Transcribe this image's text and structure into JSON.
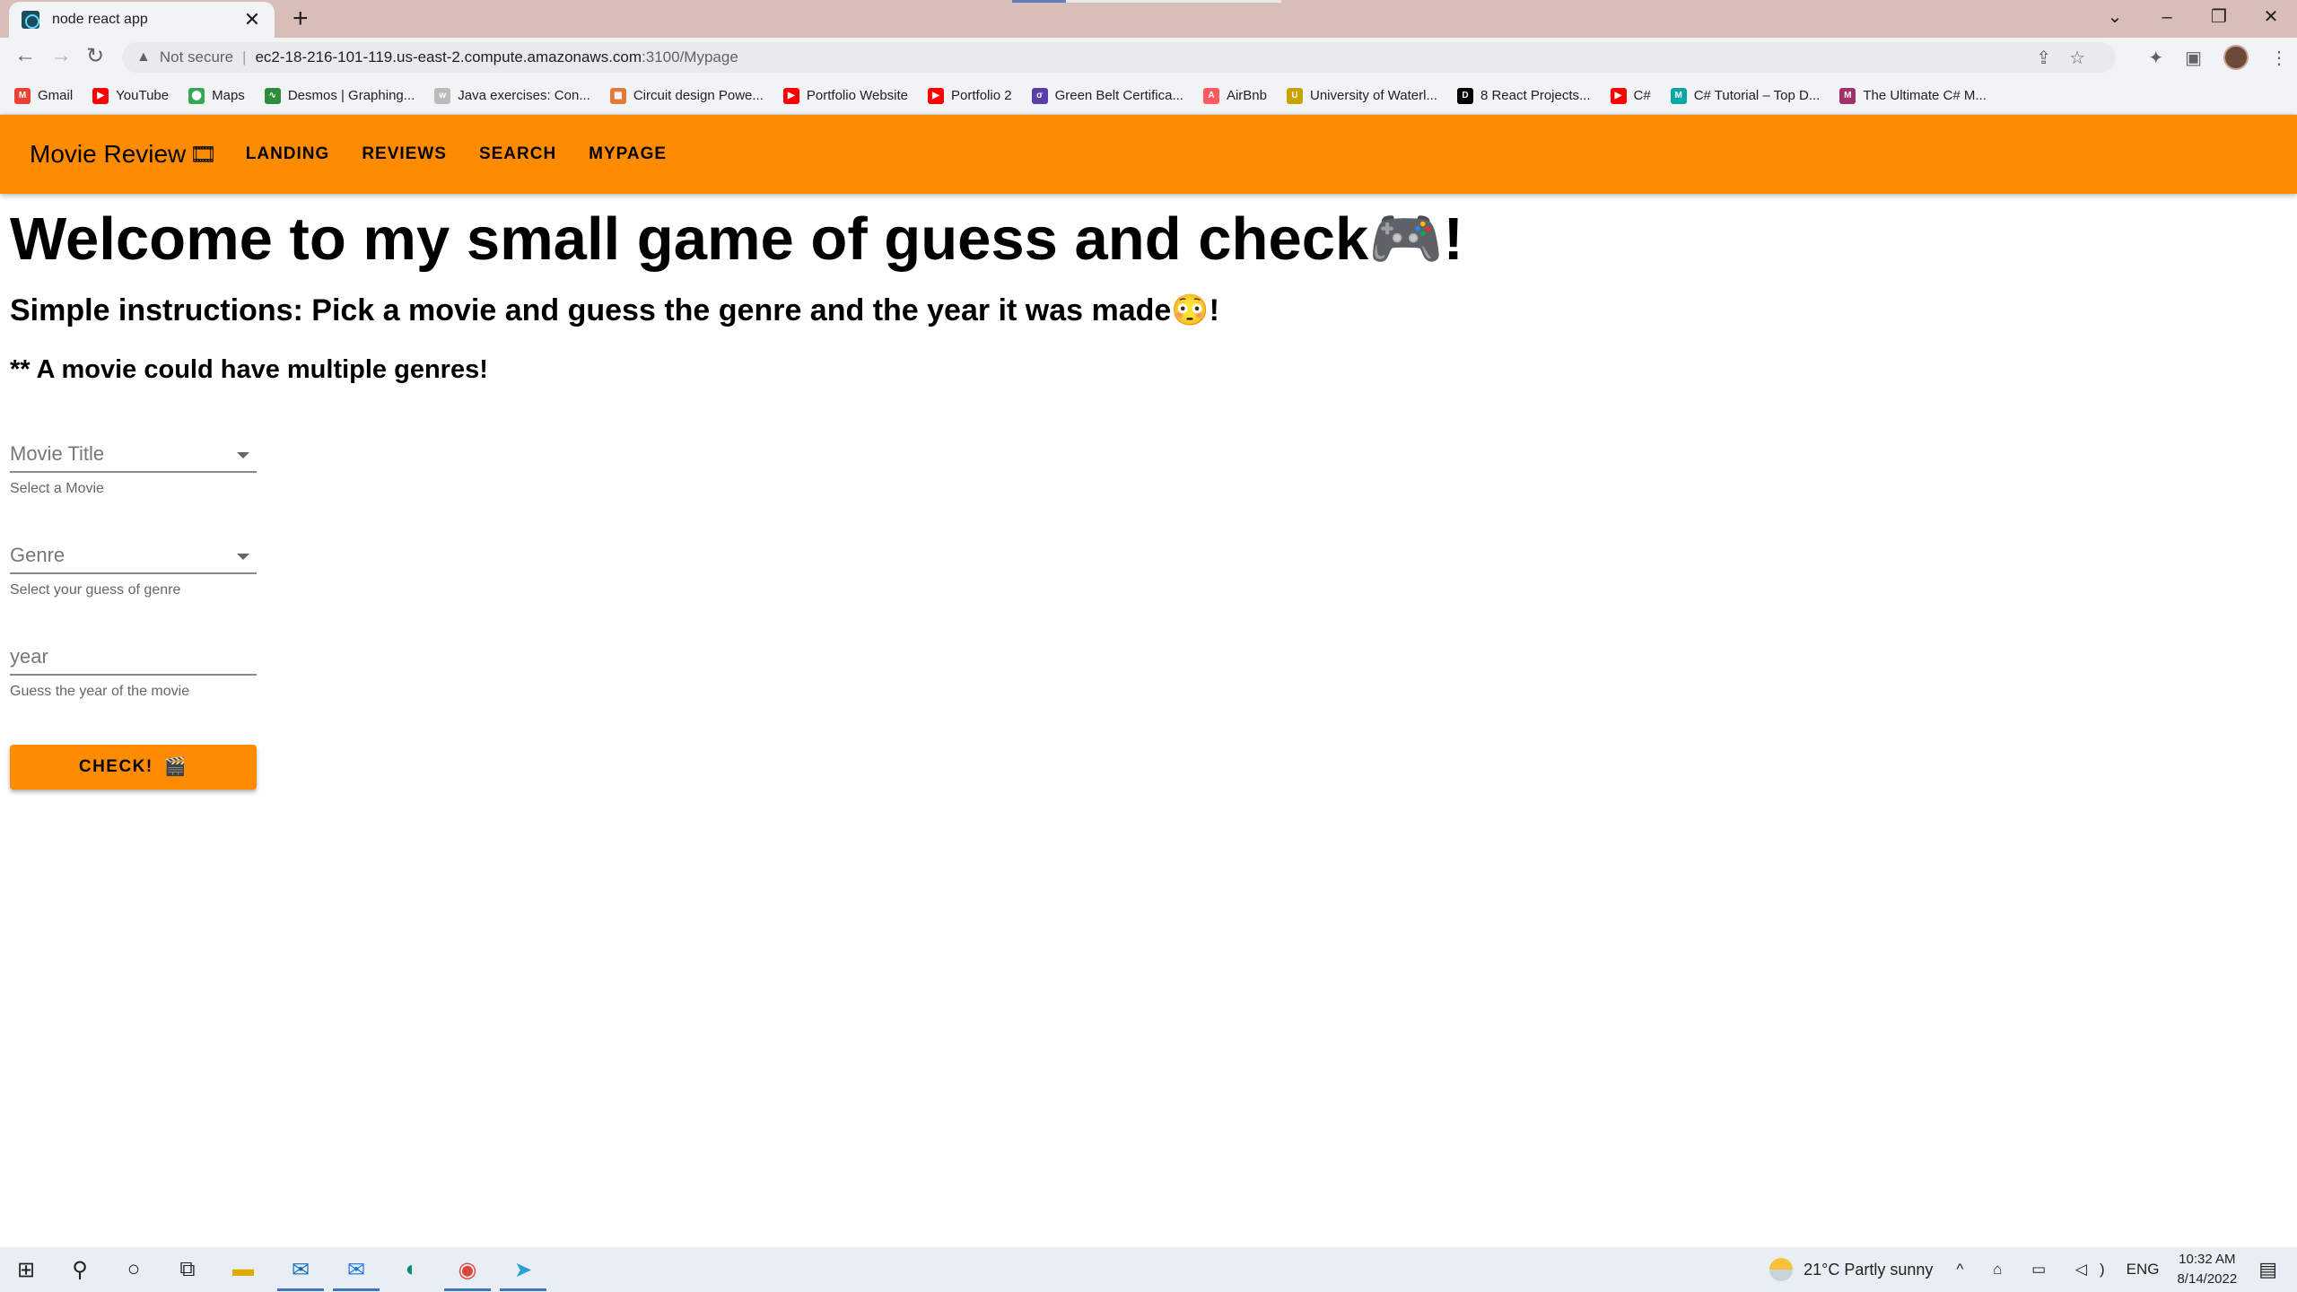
{
  "browser": {
    "tab_title": "node react app",
    "tab_close": "✕",
    "new_tab": "+",
    "not_secure": "Not secure",
    "url_host": "ec2-18-216-101-119.us-east-2.compute.amazonaws.com",
    "url_path": ":3100/Mypage",
    "bookmarks": [
      {
        "label": "Gmail",
        "color": "#ea4335",
        "icon": "gmail-icon"
      },
      {
        "label": "YouTube",
        "color": "#ff0000",
        "icon": "youtube-icon"
      },
      {
        "label": "Maps",
        "color": "#34a853",
        "icon": "maps-icon"
      },
      {
        "label": "Desmos | Graphing...",
        "color": "#2f8c3c",
        "icon": "desmos-icon"
      },
      {
        "label": "Java exercises: Con...",
        "color": "#bbbbbb",
        "icon": "w3r-icon"
      },
      {
        "label": "Circuit design Powe...",
        "color": "#e07b39",
        "icon": "circuit-icon"
      },
      {
        "label": "Portfolio Website",
        "color": "#ff0000",
        "icon": "youtube-icon"
      },
      {
        "label": "Portfolio 2",
        "color": "#ff0000",
        "icon": "youtube-icon"
      },
      {
        "label": "Green Belt Certifica...",
        "color": "#5b3fa8",
        "icon": "sixsigma-icon"
      },
      {
        "label": "AirBnb",
        "color": "#ff5a5f",
        "icon": "airbnb-icon"
      },
      {
        "label": "University of Waterl...",
        "color": "#c8a300",
        "icon": "uwaterloo-icon"
      },
      {
        "label": "8 React Projects...",
        "color": "#000000",
        "icon": "dev-icon"
      },
      {
        "label": "C#",
        "color": "#ff0000",
        "icon": "youtube-icon"
      },
      {
        "label": "C# Tutorial – Top D...",
        "color": "#0aa6a6",
        "icon": "m-icon"
      },
      {
        "label": "The Ultimate C# M...",
        "color": "#a2306a",
        "icon": "udemy-icon"
      }
    ]
  },
  "app": {
    "brand": "Movie Review",
    "brand_icon": "🎞",
    "nav": [
      "LANDING",
      "REVIEWS",
      "SEARCH",
      "MYPAGE"
    ],
    "accent": "#ff8c00",
    "heading": "Welcome to my small game of guess and check🎮!",
    "instructions": "Simple instructions: Pick a movie and guess the genre and the year it was made😳!",
    "note": "** A movie could have multiple genres!",
    "fields": {
      "movie_label": "Movie Title",
      "movie_helper": "Select a Movie",
      "genre_label": "Genre",
      "genre_helper": "Select your guess of genre",
      "year_label": "year",
      "year_helper": "Guess the year of the movie"
    },
    "check_button": "CHECK!",
    "check_icon": "🎬"
  },
  "taskbar": {
    "weather": "21°C  Partly sunny",
    "lang": "ENG",
    "time": "10:32 AM",
    "date": "8/14/2022"
  }
}
